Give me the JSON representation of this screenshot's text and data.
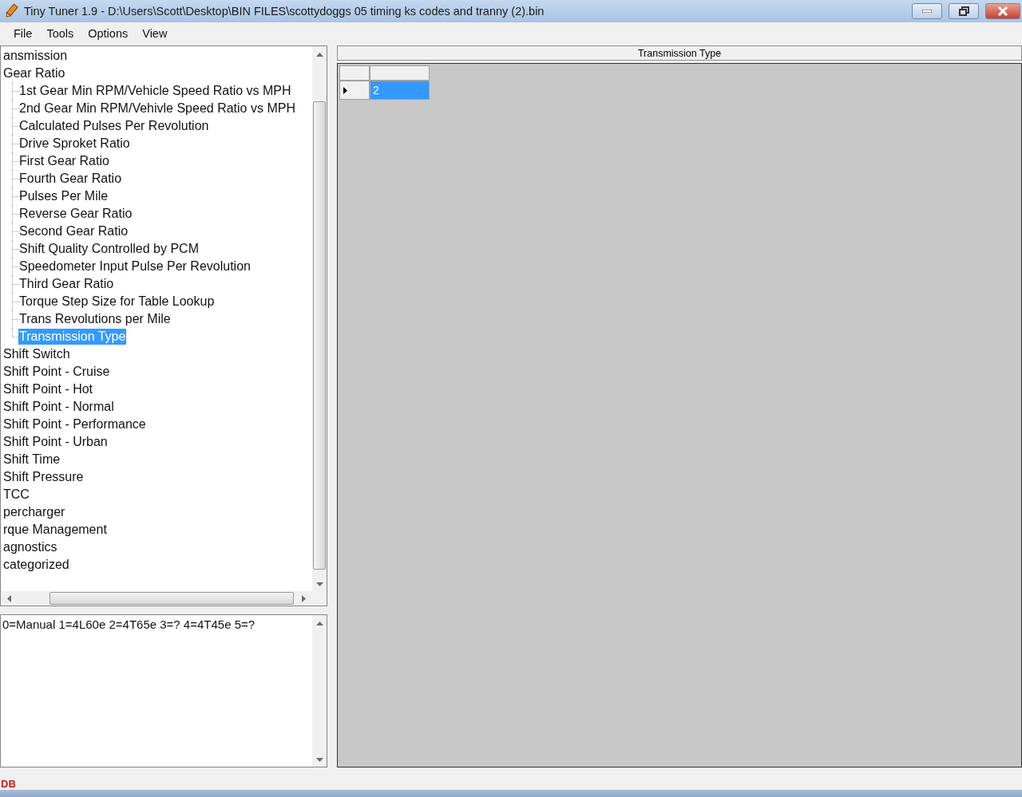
{
  "window": {
    "title": "Tiny Tuner 1.9 - D:\\Users\\Scott\\Desktop\\BIN FILES\\scottydoggs 05 timing ks codes and tranny (2).bin"
  },
  "menu": [
    "File",
    "Tools",
    "Options",
    "View"
  ],
  "tree": [
    {
      "label": "ansmission",
      "selected": false,
      "children": [
        {
          "label": "Gear Ratio",
          "selected": false,
          "children": [
            {
              "label": "1st Gear Min RPM/Vehicle Speed Ratio vs MPH",
              "selected": false
            },
            {
              "label": "2nd Gear Min RPM/Vehivle Speed Ratio vs MPH",
              "selected": false
            },
            {
              "label": "Calculated Pulses Per Revolution",
              "selected": false
            },
            {
              "label": "Drive Sproket Ratio",
              "selected": false
            },
            {
              "label": "First Gear Ratio",
              "selected": false
            },
            {
              "label": "Fourth Gear Ratio",
              "selected": false
            },
            {
              "label": "Pulses Per Mile",
              "selected": false
            },
            {
              "label": "Reverse Gear Ratio",
              "selected": false
            },
            {
              "label": "Second Gear Ratio",
              "selected": false
            },
            {
              "label": "Shift Quality Controlled by PCM",
              "selected": false
            },
            {
              "label": "Speedometer Input Pulse Per Revolution",
              "selected": false
            },
            {
              "label": "Third Gear Ratio",
              "selected": false
            },
            {
              "label": "Torque Step Size for Table Lookup",
              "selected": false
            },
            {
              "label": "Trans Revolutions per Mile",
              "selected": false
            },
            {
              "label": "Transmission Type",
              "selected": true
            }
          ]
        },
        {
          "label": "Shift Switch",
          "selected": false
        },
        {
          "label": "Shift Point - Cruise",
          "selected": false
        },
        {
          "label": "Shift Point - Hot",
          "selected": false
        },
        {
          "label": "Shift Point - Normal",
          "selected": false
        },
        {
          "label": "Shift Point - Performance",
          "selected": false
        },
        {
          "label": "Shift Point - Urban",
          "selected": false
        },
        {
          "label": "Shift Time",
          "selected": false
        },
        {
          "label": "Shift Pressure",
          "selected": false
        },
        {
          "label": "TCC",
          "selected": false
        }
      ]
    },
    {
      "label": "percharger",
      "selected": false
    },
    {
      "label": "rque Management",
      "selected": false
    },
    {
      "label": "agnostics",
      "selected": false
    },
    {
      "label": "categorized",
      "selected": false
    }
  ],
  "description": "0=Manual 1=4L60e 2=4T65e 3=? 4=4T45e 5=?",
  "table": {
    "title": "Transmission Type",
    "rows": [
      {
        "value": "2",
        "selected": true
      }
    ]
  },
  "status_bar": {
    "text": "DB"
  }
}
